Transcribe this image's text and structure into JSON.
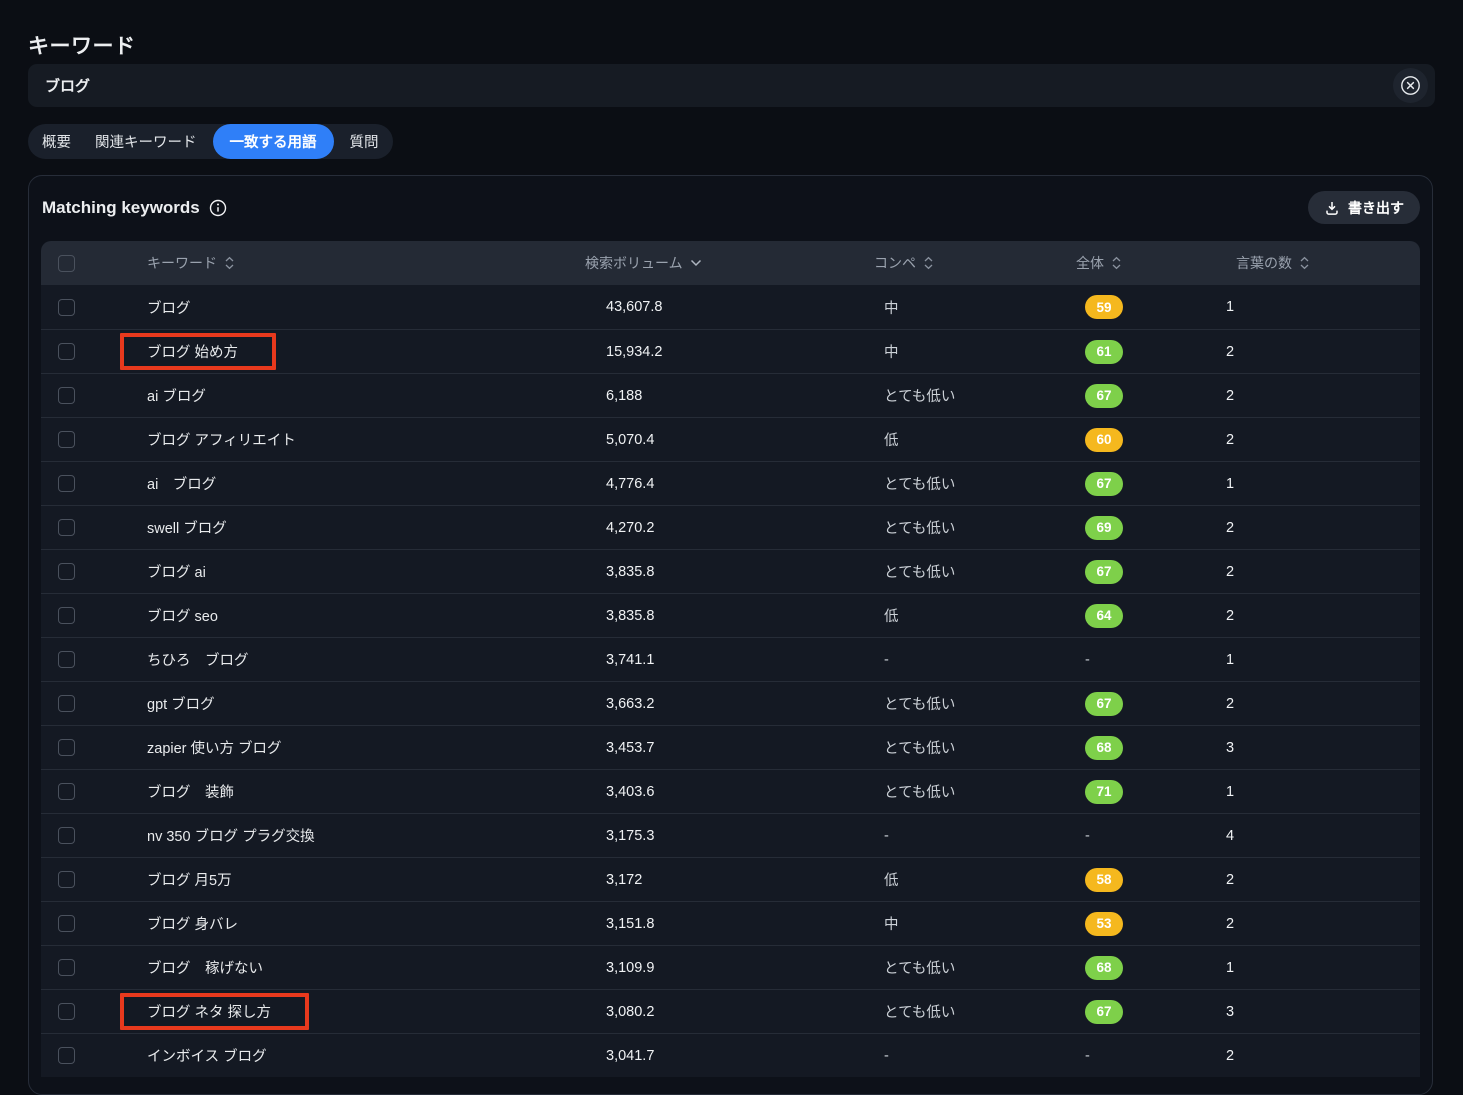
{
  "page": {
    "title": "キーワード"
  },
  "search": {
    "value": "ブログ",
    "clear_icon": "circle-x-icon"
  },
  "tabs": [
    {
      "label": "概要",
      "selected": false
    },
    {
      "label": "関連キーワード",
      "selected": false
    },
    {
      "label": "一致する用語",
      "selected": true
    },
    {
      "label": "質問",
      "selected": false
    }
  ],
  "panel": {
    "title": "Matching keywords",
    "info_icon": "info-circle-icon",
    "export_label": "書き出す",
    "export_icon": "download-icon"
  },
  "table": {
    "columns": [
      {
        "label": "キーワード",
        "sort_icon": "sort-both-icon"
      },
      {
        "label": "検索ボリューム",
        "sort_icon": "chevron-down-icon"
      },
      {
        "label": "コンペ",
        "sort_icon": "sort-both-icon"
      },
      {
        "label": "全体",
        "sort_icon": "sort-both-icon"
      },
      {
        "label": "言葉の数",
        "sort_icon": "sort-both-icon"
      }
    ],
    "rows": [
      {
        "keyword": "ブログ",
        "volume": "43,607.8",
        "competition": "中",
        "score": "59",
        "score_color": "yellow",
        "words": "1",
        "highlighted": false
      },
      {
        "keyword": "ブログ 始め方",
        "volume": "15,934.2",
        "competition": "中",
        "score": "61",
        "score_color": "green",
        "words": "2",
        "highlighted": true
      },
      {
        "keyword": "ai ブログ",
        "volume": "6,188",
        "competition": "とても低い",
        "score": "67",
        "score_color": "green",
        "words": "2",
        "highlighted": false
      },
      {
        "keyword": "ブログ アフィリエイト",
        "volume": "5,070.4",
        "competition": "低",
        "score": "60",
        "score_color": "yellow",
        "words": "2",
        "highlighted": false
      },
      {
        "keyword": "ai　ブログ",
        "volume": "4,776.4",
        "competition": "とても低い",
        "score": "67",
        "score_color": "green",
        "words": "1",
        "highlighted": false
      },
      {
        "keyword": "swell ブログ",
        "volume": "4,270.2",
        "competition": "とても低い",
        "score": "69",
        "score_color": "green",
        "words": "2",
        "highlighted": false
      },
      {
        "keyword": "ブログ ai",
        "volume": "3,835.8",
        "competition": "とても低い",
        "score": "67",
        "score_color": "green",
        "words": "2",
        "highlighted": false
      },
      {
        "keyword": "ブログ seo",
        "volume": "3,835.8",
        "competition": "低",
        "score": "64",
        "score_color": "green",
        "words": "2",
        "highlighted": false
      },
      {
        "keyword": "ちひろ　ブログ",
        "volume": "3,741.1",
        "competition": "-",
        "score": "-",
        "score_color": null,
        "words": "1",
        "highlighted": false
      },
      {
        "keyword": "gpt ブログ",
        "volume": "3,663.2",
        "competition": "とても低い",
        "score": "67",
        "score_color": "green",
        "words": "2",
        "highlighted": false
      },
      {
        "keyword": "zapier 使い方 ブログ",
        "volume": "3,453.7",
        "competition": "とても低い",
        "score": "68",
        "score_color": "green",
        "words": "3",
        "highlighted": false
      },
      {
        "keyword": "ブログ　装飾",
        "volume": "3,403.6",
        "competition": "とても低い",
        "score": "71",
        "score_color": "green",
        "words": "1",
        "highlighted": false
      },
      {
        "keyword": "nv 350 ブログ プラグ交換",
        "volume": "3,175.3",
        "competition": "-",
        "score": "-",
        "score_color": null,
        "words": "4",
        "highlighted": false
      },
      {
        "keyword": "ブログ 月5万",
        "volume": "3,172",
        "competition": "低",
        "score": "58",
        "score_color": "yellow",
        "words": "2",
        "highlighted": false
      },
      {
        "keyword": "ブログ 身バレ",
        "volume": "3,151.8",
        "competition": "中",
        "score": "53",
        "score_color": "yellow",
        "words": "2",
        "highlighted": false
      },
      {
        "keyword": "ブログ　稼げない",
        "volume": "3,109.9",
        "competition": "とても低い",
        "score": "68",
        "score_color": "green",
        "words": "1",
        "highlighted": false
      },
      {
        "keyword": "ブログ ネタ 探し方",
        "volume": "3,080.2",
        "competition": "とても低い",
        "score": "67",
        "score_color": "green",
        "words": "3",
        "highlighted": true
      },
      {
        "keyword": "インボイス ブログ",
        "volume": "3,041.7",
        "competition": "-",
        "score": "-",
        "score_color": null,
        "words": "2",
        "highlighted": false
      }
    ]
  },
  "colors": {
    "accent_blue": "#2f7ff8",
    "badge_yellow": "#f5b81e",
    "badge_green": "#7ed04a",
    "highlight_red": "#e8391d"
  }
}
